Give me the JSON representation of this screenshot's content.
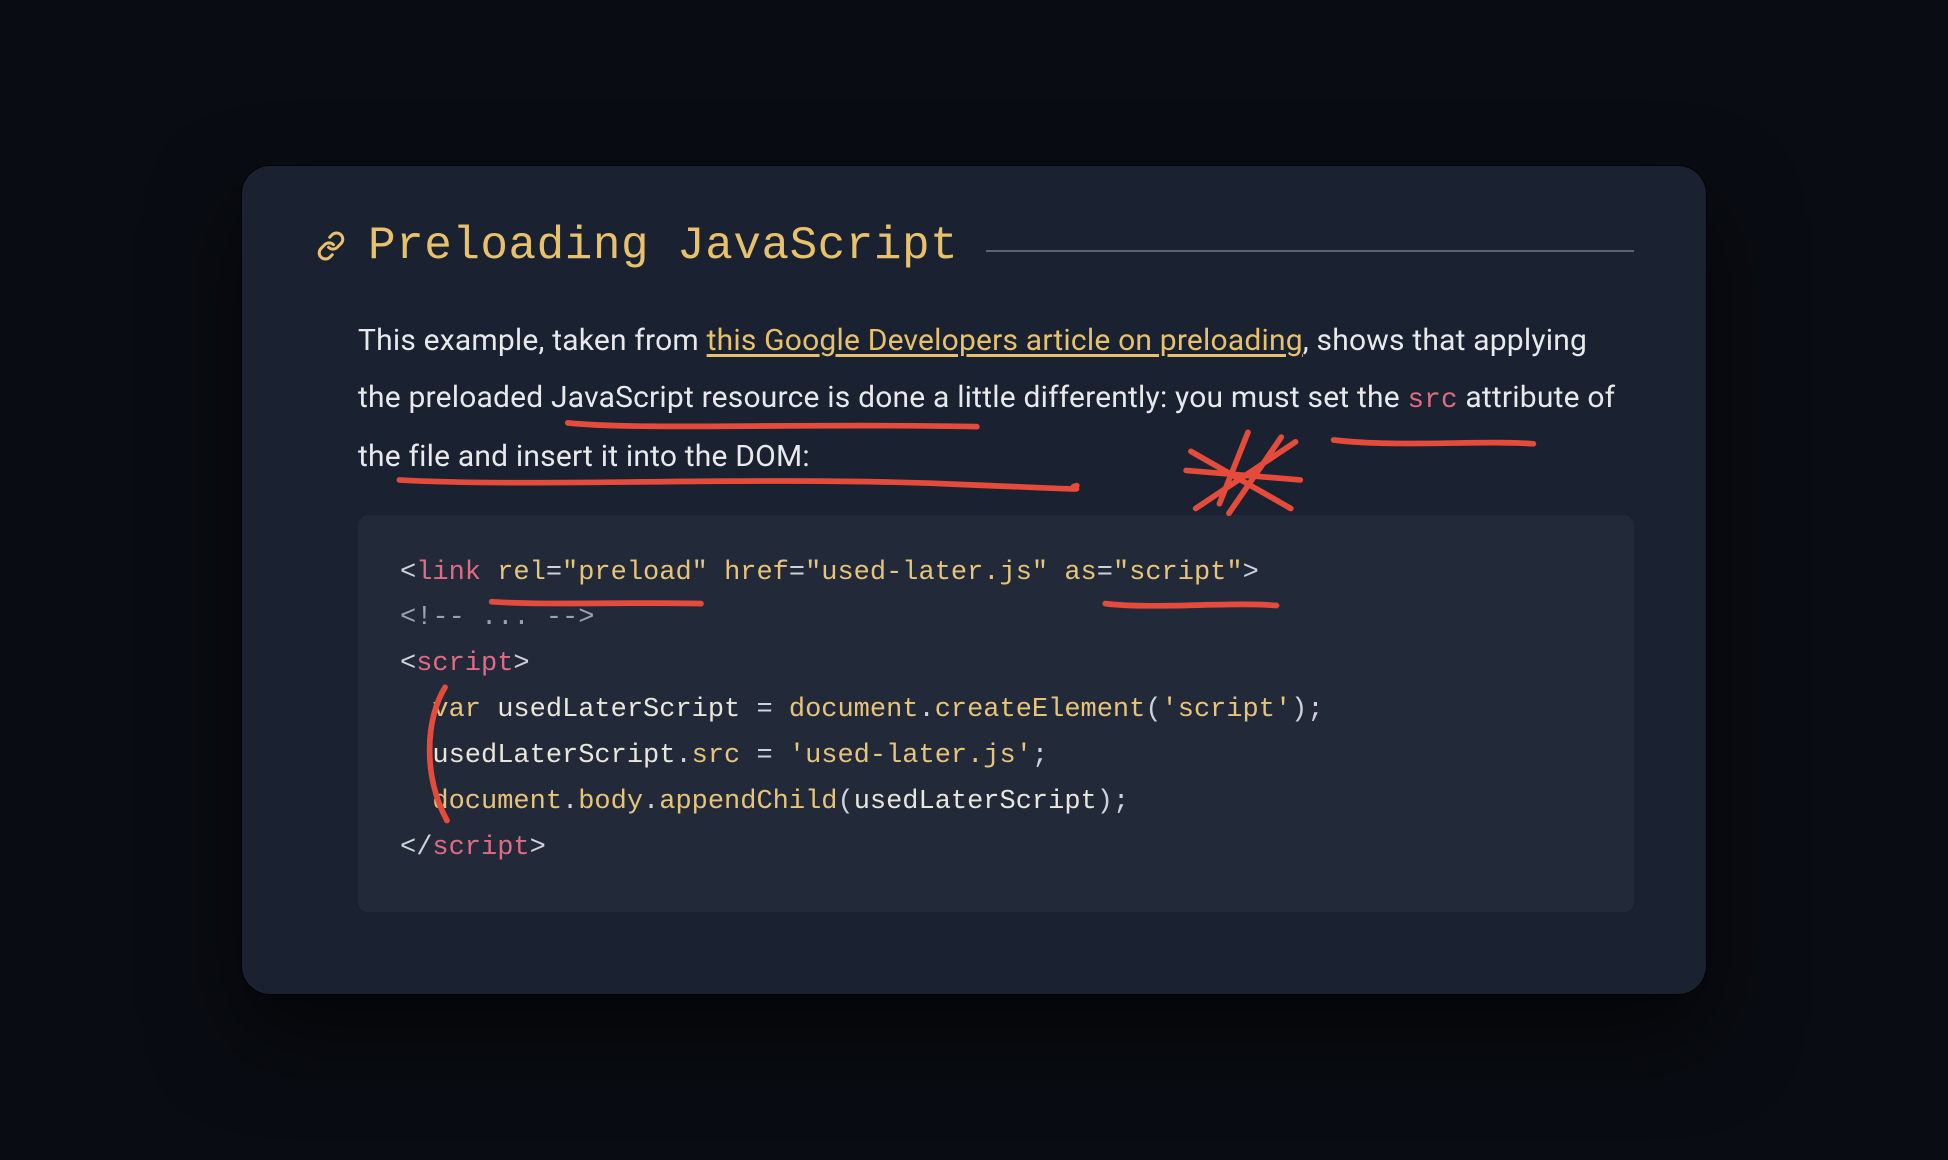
{
  "heading": "Preloading JavaScript",
  "para": {
    "pre_link": "This example, taken from ",
    "link_text": "this Google Developers article on preloading",
    "post_link_1": ", shows that applying the preloaded JavaScript resource is done a little differently: you must set the ",
    "inline_code": "src",
    "post_link_2": " attribute of the file and insert it into the DOM:"
  },
  "code": {
    "l1": {
      "open": "<",
      "tag": "link",
      "sp1": " ",
      "a1": "rel",
      "eq1": "=",
      "v1": "\"preload\"",
      "sp2": " ",
      "a2": "href",
      "eq2": "=",
      "v2": "\"used-later.js\"",
      "sp3": " ",
      "a3": "as",
      "eq3": "=",
      "v3": "\"script\"",
      "close": ">"
    },
    "l2": "<!-- ... -->",
    "l3": {
      "open": "<",
      "tag": "script",
      "close": ">"
    },
    "l4": {
      "indent": "  ",
      "kw": "var",
      "sp": " ",
      "id": "usedLaterScript",
      "sp2": " ",
      "eq": "=",
      "sp3": " ",
      "obj": "document",
      "dot": ".",
      "fn": "createElement",
      "op": "(",
      "arg": "'script'",
      "cp": ")",
      "semi": ";"
    },
    "l5": {
      "indent": "  ",
      "id": "usedLaterScript",
      "dot": ".",
      "prop": "src",
      "sp": " ",
      "eq": "=",
      "sp2": " ",
      "str": "'used-later.js'",
      "semi": ";"
    },
    "l6": {
      "indent": "  ",
      "obj": "document",
      "d1": ".",
      "p1": "body",
      "d2": ".",
      "fn": "appendChild",
      "op": "(",
      "arg": "usedLaterScript",
      "cp": ")",
      "semi": ";"
    },
    "l7": {
      "open": "</",
      "tag": "script",
      "close": ">"
    }
  },
  "annotations": {
    "color": "#e44b3a",
    "strokes": [
      "underline rel=\"preload\"",
      "underline as=\"script\"",
      "underline preloaded JavaScript resource",
      "underline you must set",
      "underline src attribute … into the DOM",
      "star doodle right of paragraph",
      "bracket curve left of var/src/document lines"
    ]
  }
}
